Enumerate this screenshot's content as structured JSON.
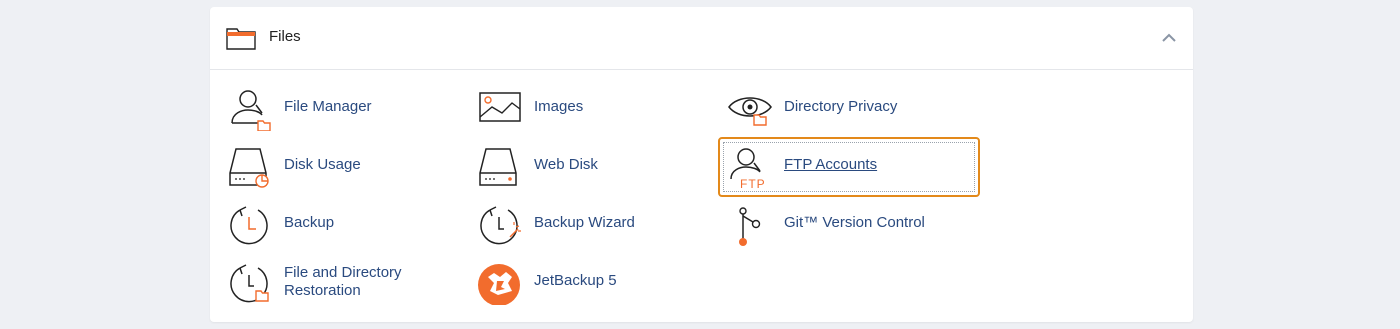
{
  "section": {
    "title": "Files",
    "accent_color": "#f26c2d",
    "focus_color": "#e3891a",
    "link_color": "#2a4a7f"
  },
  "items": [
    {
      "label": "File Manager",
      "icon": "file-manager-icon"
    },
    {
      "label": "Images",
      "icon": "images-icon"
    },
    {
      "label": "Directory Privacy",
      "icon": "directory-privacy-icon"
    },
    {
      "label": "Disk Usage",
      "icon": "disk-usage-icon"
    },
    {
      "label": "Web Disk",
      "icon": "web-disk-icon"
    },
    {
      "label": "FTP Accounts",
      "icon": "ftp-accounts-icon",
      "icon_text": "FTP"
    },
    {
      "label": "Backup",
      "icon": "backup-icon"
    },
    {
      "label": "Backup Wizard",
      "icon": "backup-wizard-icon"
    },
    {
      "label": "Git™ Version Control",
      "icon": "git-icon"
    },
    {
      "label": "File and Directory Restoration",
      "icon": "file-restoration-icon"
    },
    {
      "label": "JetBackup 5",
      "icon": "jetbackup-icon"
    }
  ]
}
